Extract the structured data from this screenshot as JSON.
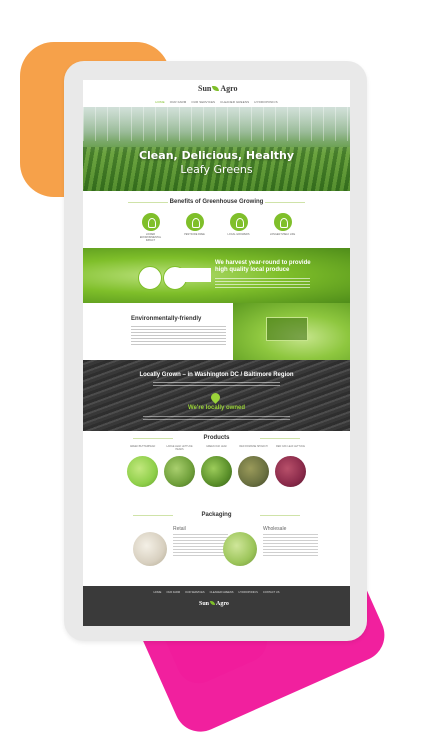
{
  "site": {
    "logo_left": "Sun",
    "logo_right": "Agro",
    "nav": [
      "Home",
      "Our Farm",
      "Our Services",
      "Cleaner Greens",
      "Hydroponics"
    ],
    "active_nav": "Home"
  },
  "hero": {
    "title_line1": "Clean, Delicious, Healthy",
    "title_line2": "Leafy Greens"
  },
  "benefits": {
    "title": "Benefits of Greenhouse Growing",
    "items": [
      {
        "label": "Lower environmental impact"
      },
      {
        "label": "Pesticide free"
      },
      {
        "label": "Local growers"
      },
      {
        "label": "Longer shelf life"
      }
    ]
  },
  "harvest": {
    "heading": "We harvest year-round to provide high quality local produce"
  },
  "environment": {
    "heading": "Environmentally-friendly"
  },
  "local": {
    "heading": "Locally Grown – in Washington DC / Baltimore Region",
    "owned": "We're locally owned"
  },
  "products": {
    "title": "Products",
    "items": [
      {
        "label": "Green Butterhead",
        "color": "#8fcf4a"
      },
      {
        "label": "Large Leaf Lettuce Heads",
        "color": "#6f9f3a"
      },
      {
        "label": "Green Oak Leaf",
        "color": "#5a8f2a"
      },
      {
        "label": "Red Romaine Spinach",
        "color": "#6a7040"
      },
      {
        "label": "Red Oak Leaf Lettuce",
        "color": "#8a2a4a"
      }
    ]
  },
  "packaging": {
    "title": "Packaging",
    "retail": "Retail",
    "wholesale": "Wholesale"
  },
  "footer": {
    "nav": [
      "Home",
      "Our Farm",
      "Our Services",
      "Cleaner Greens",
      "Hydroponics",
      "Contact Us"
    ],
    "logo_left": "Sun",
    "logo_right": "Agro"
  },
  "colors": {
    "accent_green": "#7fbf2a",
    "deco_orange": "#f6a14a",
    "deco_pink": "#f0179a"
  }
}
